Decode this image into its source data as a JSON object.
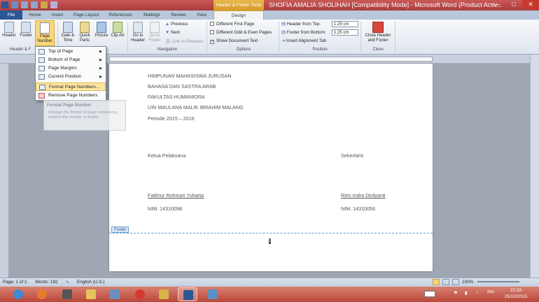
{
  "window": {
    "title": "SHOFIA AMALIA SHOLIHAH [Compatibility Mode] - Microsoft Word (Product Activ...",
    "contextual_group": "Header & Footer Tools",
    "controls": {
      "minimize": "—",
      "maximize": "□",
      "close": "✕"
    }
  },
  "tabs": [
    {
      "label": "File"
    },
    {
      "label": "Home"
    },
    {
      "label": "Insert"
    },
    {
      "label": "Page Layout"
    },
    {
      "label": "References"
    },
    {
      "label": "Mailings"
    },
    {
      "label": "Review"
    },
    {
      "label": "View"
    },
    {
      "label": "Design"
    }
  ],
  "ribbon": {
    "hf_group": {
      "header": "Header",
      "footer": "Footer",
      "page_number": "Page Number",
      "label": "Header & F"
    },
    "insert_group": {
      "date_time": "Date & Time",
      "quick_parts": "Quick Parts",
      "picture": "Picture",
      "clip_art": "Clip Art"
    },
    "navigation": {
      "goto_header": "Go to Header",
      "goto_footer": "Go to Footer",
      "previous": "Previous",
      "next": "Next",
      "link_prev": "Link to Previous",
      "label": "Navigation"
    },
    "options": {
      "diff_first": "Different First Page",
      "diff_odd_even": "Different Odd & Even Pages",
      "show_doc_text": "Show Document Text",
      "show_doc_text_checked": true,
      "label": "Options"
    },
    "position": {
      "header_from_top": "Header from Top:",
      "header_value": "1,25 cm",
      "footer_from_bottom": "Footer from Bottom:",
      "footer_value": "1,25 cm",
      "insert_alignment_tab": "Insert Alignment Tab",
      "label": "Position"
    },
    "close": {
      "button": "Close Header and Footer",
      "label": "Close"
    }
  },
  "menu": {
    "items": [
      {
        "label": "Top of Page",
        "submenu": true
      },
      {
        "label": "Bottom of Page",
        "submenu": true
      },
      {
        "label": "Page Margins",
        "submenu": true
      },
      {
        "label": "Current Position",
        "submenu": true
      },
      {
        "label": "Format Page Numbers...",
        "submenu": false,
        "highlight": true
      },
      {
        "label": "Remove Page Numbers",
        "submenu": false
      }
    ],
    "tooltip": {
      "title": "Format Page Number",
      "description": "Change the format of page numbering used in the header or footer."
    }
  },
  "document": {
    "lines": [
      "HIMPUNAN MAHASISWA JURUSAN",
      "BAHASA DAN SASTRA ARAB",
      "FAKULTAS HUMANIORA",
      "UIN MAULANA MALIK IBRAHIM MALANG",
      "Periode 2015 – 2016"
    ],
    "left_role": "Ketua Pelaksana",
    "right_role": "Sekertaris",
    "left_name": "Fatkhur Rohman Yuharta",
    "right_name": "Ririn Indra Dirdyanti",
    "left_nim": "NIM. 14310098",
    "right_nim": "NIM. 14310056",
    "footer_tag": "Footer",
    "page_number": "1"
  },
  "status": {
    "page": "Page: 1 of 2",
    "words": "Words: 192",
    "language": "English (U.S.)",
    "zoom": "100%"
  },
  "taskbar": {
    "lang": "IND",
    "time": "22:33",
    "date": "25/10/2015"
  },
  "colors": {
    "titlebar": "#b84a4a",
    "file_tab": "#2b5797",
    "highlight": "#fce6a4"
  }
}
